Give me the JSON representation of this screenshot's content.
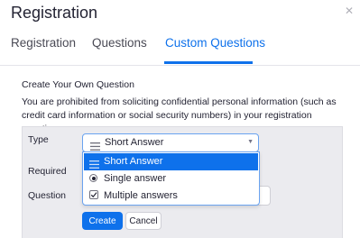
{
  "dialog": {
    "title": "Registration",
    "close_icon": "close-icon"
  },
  "tabs": [
    {
      "label": "Registration",
      "active": false
    },
    {
      "label": "Questions",
      "active": false
    },
    {
      "label": "Custom Questions",
      "active": true
    }
  ],
  "section": {
    "title": "Create Your Own Question",
    "notice": "You are prohibited from soliciting confidential personal information (such as credit card information or social security numbers) in your registration questions."
  },
  "form": {
    "type_label": "Type",
    "required_label": "Required",
    "question_label": "Question",
    "type_select": {
      "selected": "Short Answer",
      "icon": "lines-icon",
      "options": [
        {
          "label": "Short Answer",
          "icon": "lines-icon",
          "highlighted": true
        },
        {
          "label": "Single answer",
          "icon": "radio-icon",
          "highlighted": false
        },
        {
          "label": "Multiple answers",
          "icon": "checkbox-icon",
          "highlighted": false
        }
      ]
    },
    "question_value": "",
    "create_label": "Create",
    "cancel_label": "Cancel"
  },
  "colors": {
    "accent": "#0e71eb",
    "panel_bg": "#ebebef",
    "text": "#232333"
  }
}
